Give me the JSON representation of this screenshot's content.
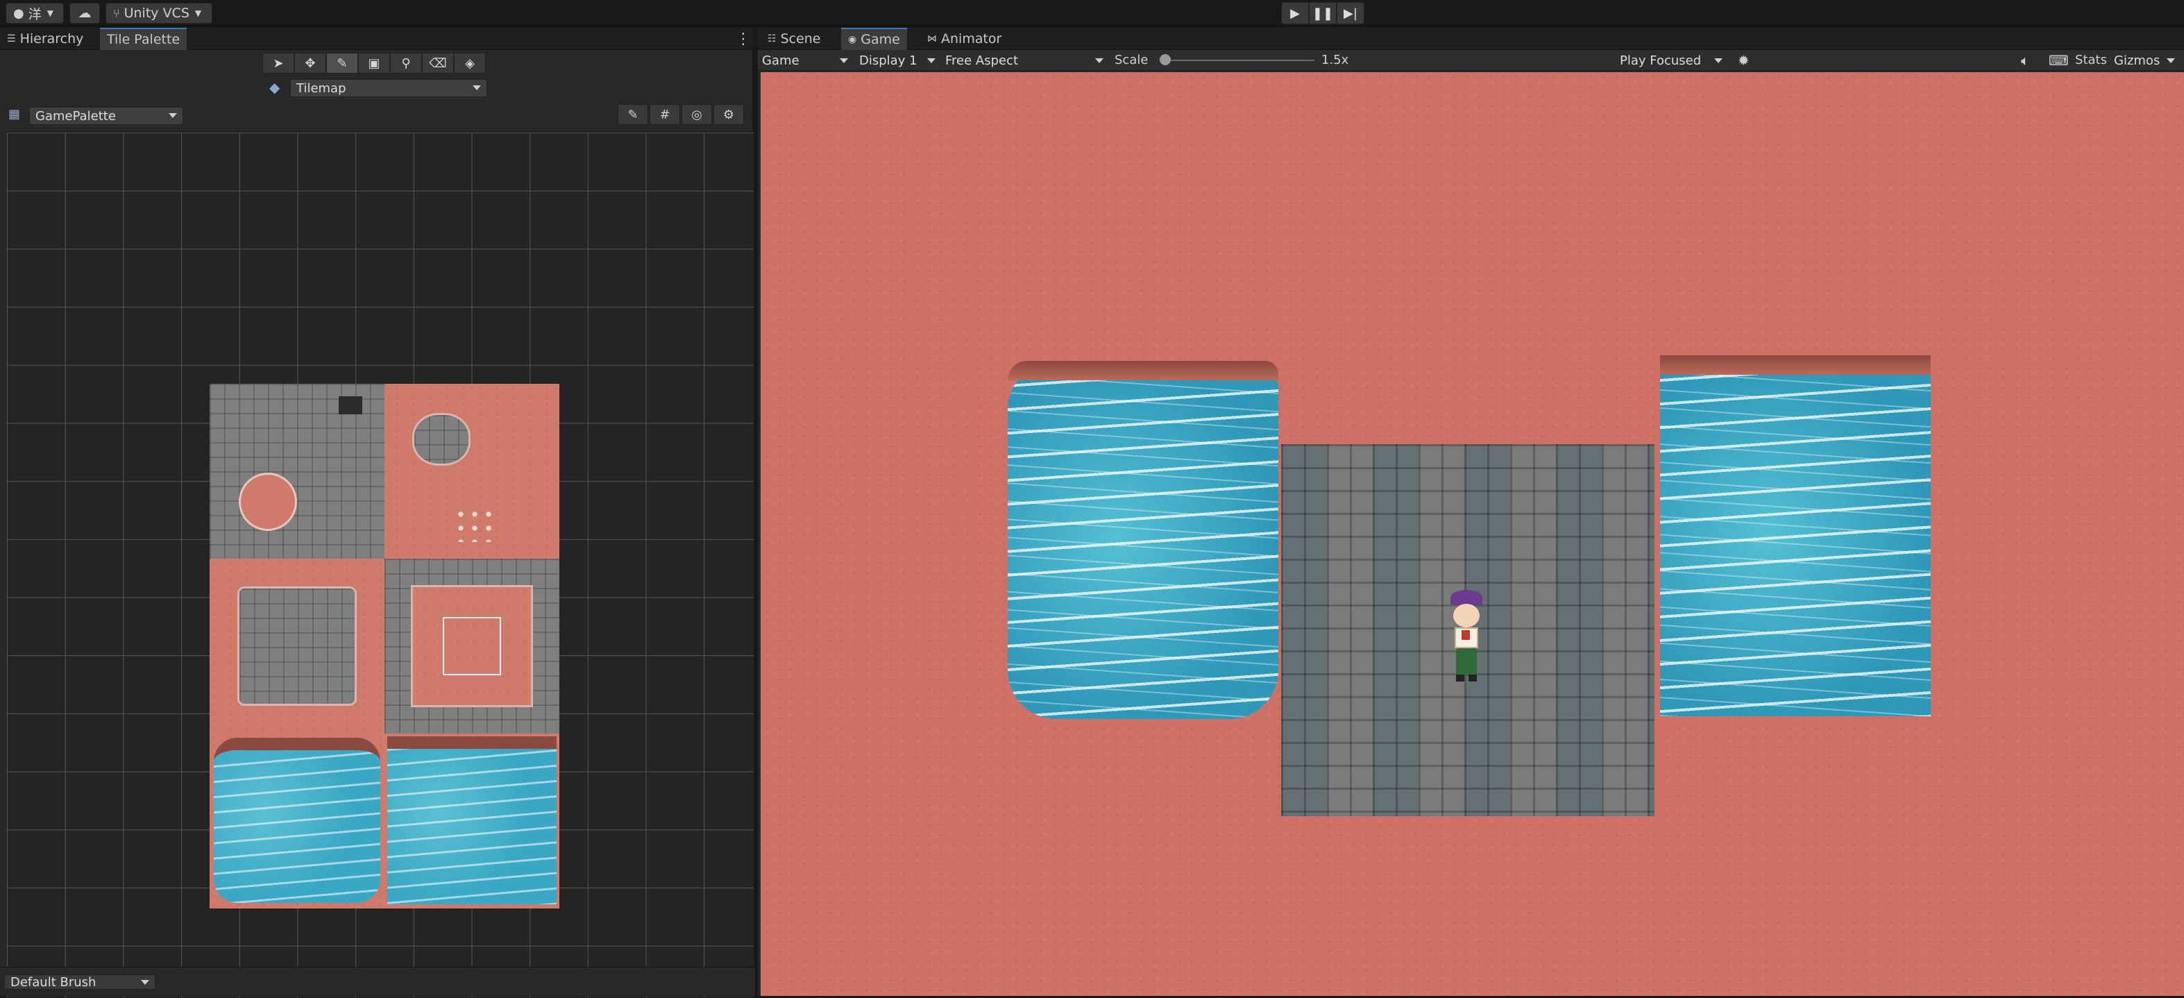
{
  "topbar": {
    "account_label": "洋",
    "vcs_label": "Unity VCS",
    "play_icon": "play-icon",
    "pause_icon": "pause-icon",
    "step_icon": "step-icon"
  },
  "left_panel": {
    "tabs": [
      {
        "label": "Hierarchy"
      },
      {
        "label": "Tile Palette"
      }
    ],
    "tools": [
      "select-icon",
      "move-icon",
      "paint-brush-icon",
      "box-fill-icon",
      "picker-icon",
      "eraser-icon",
      "fill-icon"
    ],
    "active_tilemap": "Tilemap",
    "palette": "GamePalette",
    "brush": "Default Brush"
  },
  "right_panel": {
    "tabs": [
      {
        "label": "Scene"
      },
      {
        "label": "Game"
      },
      {
        "label": "Animator"
      }
    ],
    "game_toolbar": {
      "mode": "Game",
      "display": "Display 1",
      "aspect": "Free Aspect",
      "scale_label": "Scale",
      "scale_value": "1.5x",
      "play_mode": "Play Focused",
      "stats": "Stats",
      "gizmos": "Gizmos"
    }
  },
  "colors": {
    "sand": "#cf7166",
    "water": "#3aa5c3",
    "stone": "#7b7b7b",
    "accent": "#3a79bb"
  }
}
